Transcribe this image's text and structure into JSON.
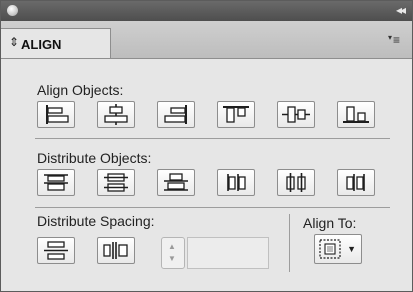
{
  "panel": {
    "collapse_glyph": "◂◂",
    "tab_arrows": "⇕",
    "tab_label": "ALIGN",
    "menu_glyph": "≡"
  },
  "sections": {
    "align_objects": "Align Objects:",
    "distribute_objects": "Distribute Objects:",
    "distribute_spacing": "Distribute Spacing:",
    "align_to": "Align To:"
  },
  "align_buttons": [
    {
      "icon": "align-left-edges-icon"
    },
    {
      "icon": "align-horizontal-centers-icon"
    },
    {
      "icon": "align-right-edges-icon"
    },
    {
      "icon": "align-top-edges-icon"
    },
    {
      "icon": "align-vertical-centers-icon"
    },
    {
      "icon": "align-bottom-edges-icon"
    }
  ],
  "distribute_buttons": [
    {
      "icon": "distribute-top-edges-icon"
    },
    {
      "icon": "distribute-vertical-centers-icon"
    },
    {
      "icon": "distribute-bottom-edges-icon"
    },
    {
      "icon": "distribute-left-edges-icon"
    },
    {
      "icon": "distribute-horizontal-centers-icon"
    },
    {
      "icon": "distribute-right-edges-icon"
    }
  ],
  "spacing": {
    "field_value": ""
  },
  "colors": {
    "panel_bg": "#e6e6e6",
    "titlebar": "#5a5a5a",
    "icon_stroke": "#1e1e1e"
  }
}
